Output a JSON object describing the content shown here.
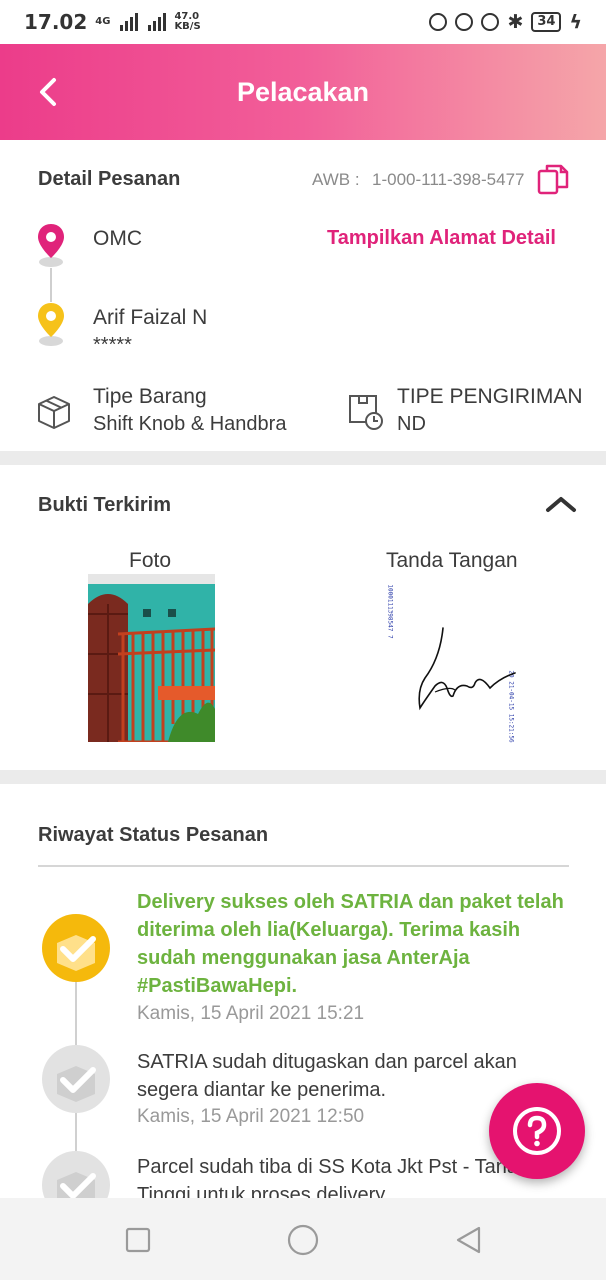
{
  "status_bar": {
    "time": "17.02",
    "network_type": "4G",
    "net_speed_value": "47.0",
    "net_speed_unit": "KB/S",
    "battery": "34"
  },
  "appbar": {
    "title": "Pelacakan"
  },
  "order_detail": {
    "heading": "Detail Pesanan",
    "awb_label": "AWB :",
    "awb_value": "1-000-111-398-5477",
    "origin_name": "OMC",
    "show_address_link": "Tampilkan Alamat Detail",
    "receiver_name": "Arif Faizal N",
    "receiver_masked": "*****",
    "item_type_label": "Tipe Barang",
    "item_type_value": "Shift Knob & Handbra",
    "shipping_type_label": "TIPE PENGIRIMAN",
    "shipping_type_value": "ND"
  },
  "proof": {
    "heading": "Bukti Terkirim",
    "photo_label": "Foto",
    "signature_label": "Tanda Tangan",
    "signature_stamp_top": "1000111398547 7",
    "signature_stamp_side": "20 21-04-15 15:21:56"
  },
  "history": {
    "heading": "Riwayat Status Pesanan",
    "items": [
      {
        "text": "Delivery sukses oleh SATRIA dan paket telah diterima oleh lia(Keluarga). Terima kasih sudah menggunakan jasa AnterAja #PastiBawaHepi.",
        "date": "Kamis, 15 April 2021 15:21",
        "active": true
      },
      {
        "text": "SATRIA sudah ditugaskan dan parcel akan segera diantar ke penerima.",
        "date": "Kamis, 15 April 2021 12:50",
        "active": false
      },
      {
        "text": "Parcel sudah tiba di SS Kota Jkt Pst - Tanah Tinggi untuk proses delivery.",
        "date": "",
        "active": false
      }
    ]
  },
  "colors": {
    "brand_pink": "#e0237a",
    "success_green": "#6db33f",
    "pin_yellow": "#f6c21a"
  }
}
